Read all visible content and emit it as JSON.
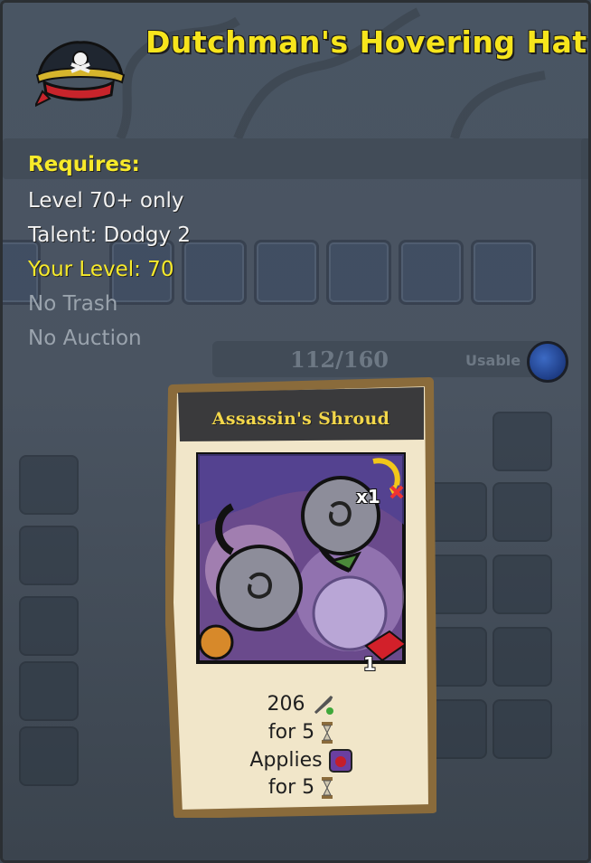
{
  "item": {
    "title": "Dutchman's Hovering Hat",
    "icon": "pirate-hat-icon"
  },
  "requirements": {
    "heading": "Requires:",
    "level": "Level 70+ only",
    "talent": "Talent: Dodgy 2",
    "your_level": "Your Level: 70",
    "no_trash": "No Trash",
    "no_auction": "No Auction"
  },
  "background": {
    "bag_count": "112/160",
    "usable_label": "Usable"
  },
  "card": {
    "name": "Assassin's Shroud",
    "copies": "x1",
    "range": "1",
    "damage_value": "206",
    "damage_duration": "for 5",
    "applies_label": "Applies",
    "applies_duration": "for 5",
    "icons": {
      "damage": "sword-poison-icon",
      "rounds": "hourglass-icon",
      "effect": "bleed-icon",
      "range": "range-grid-icon",
      "copies": "swap-arrow-icon",
      "class": "fist-icon"
    }
  },
  "colors": {
    "title_yellow": "#f7e51c",
    "card_parchment": "#f1e6c9",
    "card_border": "#8a6b3b",
    "art_purple": "#7e5aa0"
  }
}
